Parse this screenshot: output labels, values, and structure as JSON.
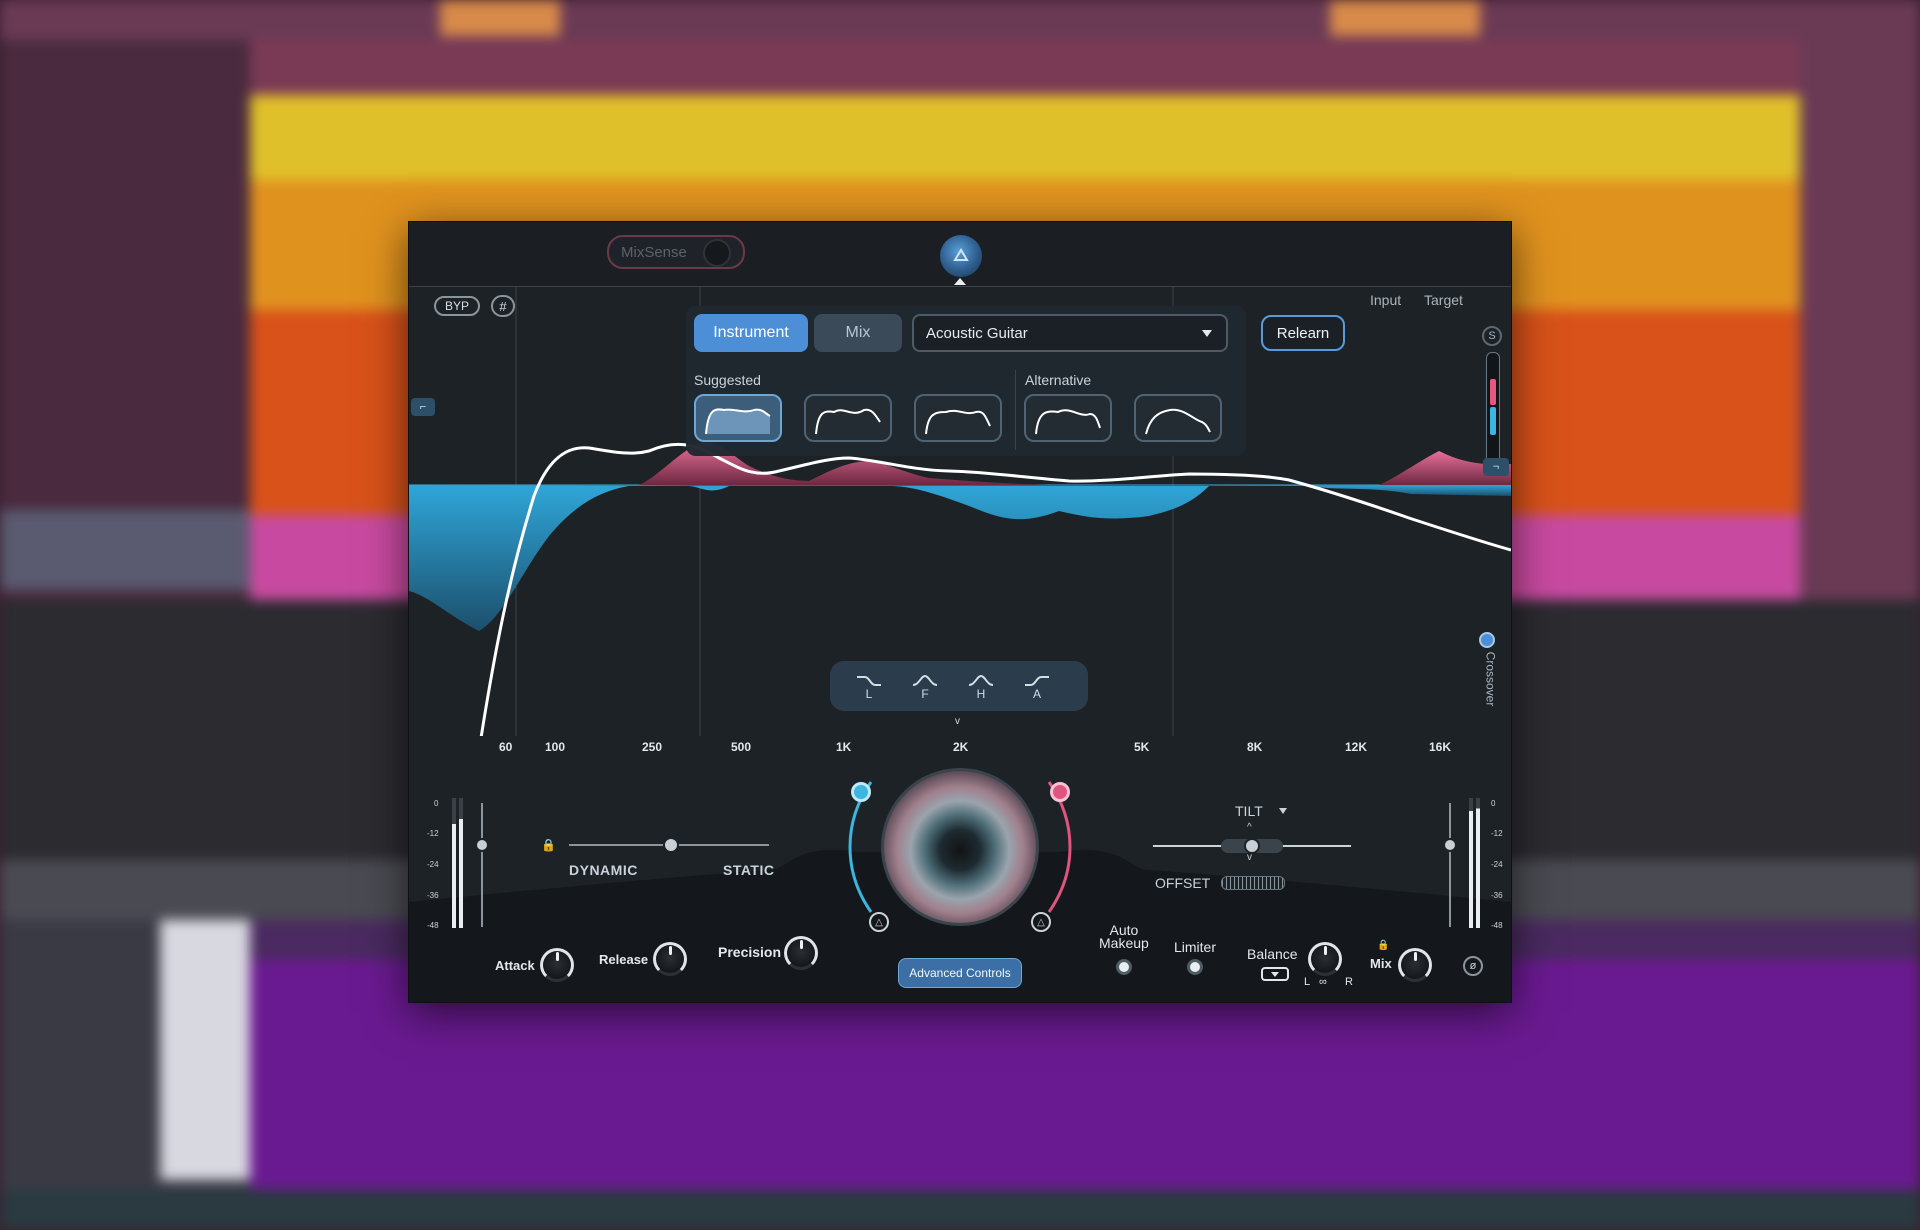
{
  "plugin": {
    "mixsense_label": "MixSense",
    "byp_label": "BYP",
    "hash_icon": "grid-icon",
    "input_label": "Input",
    "target_label": "Target",
    "s_label": "S",
    "mode_tabs": [
      {
        "label": "Instrument",
        "active": true
      },
      {
        "label": "Mix",
        "active": false
      }
    ],
    "preset_value": "Acoustic Guitar",
    "relearn_label": "Relearn",
    "suggested_label": "Suggested",
    "alternative_label": "Alternative",
    "crossover_label": "Crossover",
    "filter_buttons": [
      "L",
      "F",
      "H",
      "A"
    ],
    "freq_labels": [
      "60",
      "100",
      "250",
      "500",
      "1K",
      "2K",
      "5K",
      "8K",
      "12K",
      "16K"
    ],
    "meter_ticks": [
      "0",
      "-12",
      "-24",
      "-36",
      "-48"
    ],
    "dynamic_label": "DYNAMIC",
    "static_label": "STATIC",
    "tilt_label": "TILT",
    "offset_label": "OFFSET",
    "attack_label": "Attack",
    "release_label": "Release",
    "precision_label": "Precision",
    "advanced_label": "Advanced Controls",
    "auto_makeup_label": "Auto\nMakeup",
    "limiter_label": "Limiter",
    "balance_label": "Balance",
    "balance_l": "L",
    "balance_r": "R",
    "mix_label": "Mix",
    "colors": {
      "accent": "#4c8fd6",
      "cyan": "#3ab6e0",
      "pink": "#e0557f",
      "curve": "#ffffff",
      "panel": "#1d2227"
    }
  }
}
